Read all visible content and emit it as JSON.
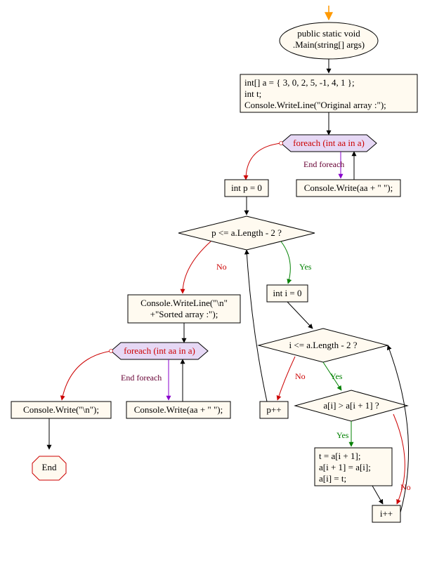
{
  "chart_data": {
    "type": "flowchart",
    "title": "",
    "nodes": [
      {
        "id": "start",
        "shape": "ellipse",
        "text": [
          "public static void",
          ".Main(string[] args)"
        ]
      },
      {
        "id": "init",
        "shape": "rect",
        "text": [
          "int[] a = { 3, 0, 2, 5, -1, 4, 1 };",
          "int t;",
          "Console.WriteLine(\"Original array :\");"
        ]
      },
      {
        "id": "foreach1",
        "shape": "hex",
        "text": "foreach (int aa in a)"
      },
      {
        "id": "write1",
        "shape": "rect",
        "text": "Console.Write(aa + \" \");"
      },
      {
        "id": "p0",
        "shape": "rect",
        "text": "int p = 0"
      },
      {
        "id": "cond_p",
        "shape": "diamond",
        "text": "p <= a.Length - 2 ?"
      },
      {
        "id": "i0",
        "shape": "rect",
        "text": "int i = 0"
      },
      {
        "id": "cond_i",
        "shape": "diamond",
        "text": "i <= a.Length - 2 ?"
      },
      {
        "id": "cond_swap",
        "shape": "diamond",
        "text": "a[i] > a[i + 1] ?"
      },
      {
        "id": "swap",
        "shape": "rect",
        "text": [
          "t = a[i + 1];",
          "a[i + 1] = a[i];",
          "a[i] = t;"
        ]
      },
      {
        "id": "ipp",
        "shape": "rect",
        "text": "i++"
      },
      {
        "id": "ppp",
        "shape": "rect",
        "text": "p++"
      },
      {
        "id": "sorted",
        "shape": "rect",
        "text": [
          "Console.WriteLine(\"\\n\"",
          "+\"Sorted array :\");"
        ]
      },
      {
        "id": "foreach2",
        "shape": "hex",
        "text": "foreach (int aa in a)"
      },
      {
        "id": "write2",
        "shape": "rect",
        "text": "Console.Write(aa + \" \");"
      },
      {
        "id": "nl",
        "shape": "rect",
        "text": "Console.Write(\"\\n\");"
      },
      {
        "id": "end",
        "shape": "octagon",
        "text": "End"
      }
    ],
    "edges": [
      {
        "from": "start",
        "to": "init"
      },
      {
        "from": "init",
        "to": "foreach1"
      },
      {
        "from": "foreach1",
        "to": "write1",
        "label": ""
      },
      {
        "from": "write1",
        "to": "foreach1"
      },
      {
        "from": "foreach1",
        "to": "p0",
        "label": "End foreach"
      },
      {
        "from": "p0",
        "to": "cond_p"
      },
      {
        "from": "cond_p",
        "to": "i0",
        "label": "Yes"
      },
      {
        "from": "cond_p",
        "to": "sorted",
        "label": "No"
      },
      {
        "from": "i0",
        "to": "cond_i"
      },
      {
        "from": "cond_i",
        "to": "cond_swap",
        "label": "Yes"
      },
      {
        "from": "cond_i",
        "to": "ppp",
        "label": "No"
      },
      {
        "from": "cond_swap",
        "to": "swap",
        "label": "Yes"
      },
      {
        "from": "cond_swap",
        "to": "ipp",
        "label": "No"
      },
      {
        "from": "swap",
        "to": "ipp"
      },
      {
        "from": "ipp",
        "to": "cond_i"
      },
      {
        "from": "ppp",
        "to": "cond_p"
      },
      {
        "from": "sorted",
        "to": "foreach2"
      },
      {
        "from": "foreach2",
        "to": "write2"
      },
      {
        "from": "write2",
        "to": "foreach2"
      },
      {
        "from": "foreach2",
        "to": "nl",
        "label": "End foreach"
      },
      {
        "from": "nl",
        "to": "end"
      }
    ],
    "labels": {
      "yes": "Yes",
      "no": "No",
      "end_foreach": "End foreach"
    }
  },
  "nodes": {
    "start_l1": "public static void",
    "start_l2": ".Main(string[] args)",
    "init_l1": "int[] a = { 3, 0, 2, 5, -1, 4, 1 };",
    "init_l2": "int t;",
    "init_l3": "Console.WriteLine(\"Original array :\");",
    "foreach1": "foreach (int aa in a)",
    "write1": "Console.Write(aa + \" \");",
    "p0": "int p = 0",
    "cond_p": "p <= a.Length - 2 ?",
    "i0": "int i = 0",
    "cond_i": "i <= a.Length - 2 ?",
    "cond_swap": "a[i] > a[i + 1] ?",
    "swap_l1": "t = a[i + 1];",
    "swap_l2": "a[i + 1] = a[i];",
    "swap_l3": "a[i] = t;",
    "ipp": "i++",
    "ppp": "p++",
    "sorted_l1": "Console.WriteLine(\"\\n\"",
    "sorted_l2": "+\"Sorted array :\");",
    "foreach2": "foreach (int aa in a)",
    "write2": "Console.Write(aa + \" \");",
    "nl": "Console.Write(\"\\n\");",
    "end": "End"
  },
  "labels": {
    "yes": "Yes",
    "no": "No",
    "end_foreach": "End foreach"
  }
}
